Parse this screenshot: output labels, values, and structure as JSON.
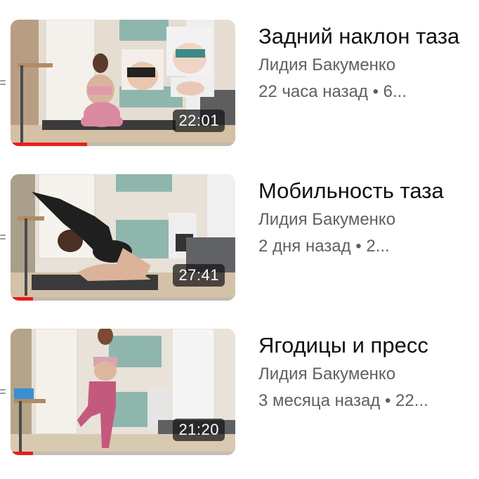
{
  "colors": {
    "progress": "#e4201b",
    "title": "#0f0f0f",
    "secondary": "#606060"
  },
  "videos": [
    {
      "title": "Задний наклон таза",
      "channel": "Лидия Бакуменко",
      "details": "22 часа назад • 6...",
      "duration": "22:01",
      "watched_fraction": 0.34
    },
    {
      "title": "Мобильность таза",
      "channel": "Лидия Бакуменко",
      "details": "2 дня назад • 2...",
      "duration": "27:41",
      "watched_fraction": 0.1
    },
    {
      "title": "Ягодицы и пресс",
      "channel": "Лидия Бакуменко",
      "details": "3 месяца назад • 22...",
      "duration": "21:20",
      "watched_fraction": 0.1
    }
  ]
}
